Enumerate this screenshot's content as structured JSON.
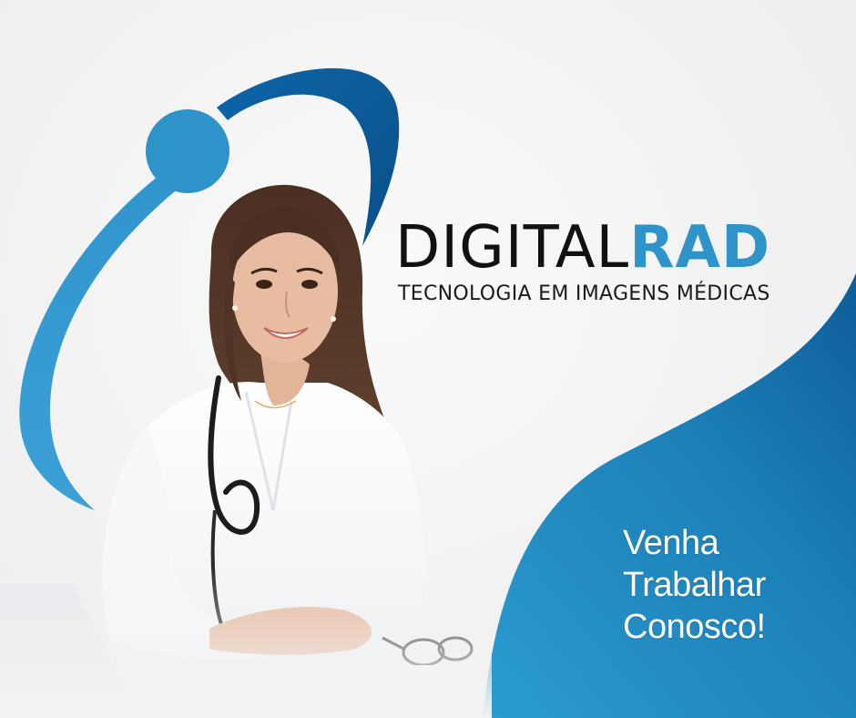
{
  "logo": {
    "word_part_1": "DIGITAL",
    "word_part_2": "RAD",
    "tagline": "TECNOLOGIA EM IMAGENS MÉDICAS"
  },
  "cta": {
    "line_1": "Venha",
    "line_2": "Trabalhar",
    "line_3": "Conosco!"
  },
  "colors": {
    "brand_light_blue": "#2e93c9",
    "brand_dark_blue": "#0b5a94",
    "wave_blue": "#1c7fb8",
    "text_dark": "#111111"
  }
}
